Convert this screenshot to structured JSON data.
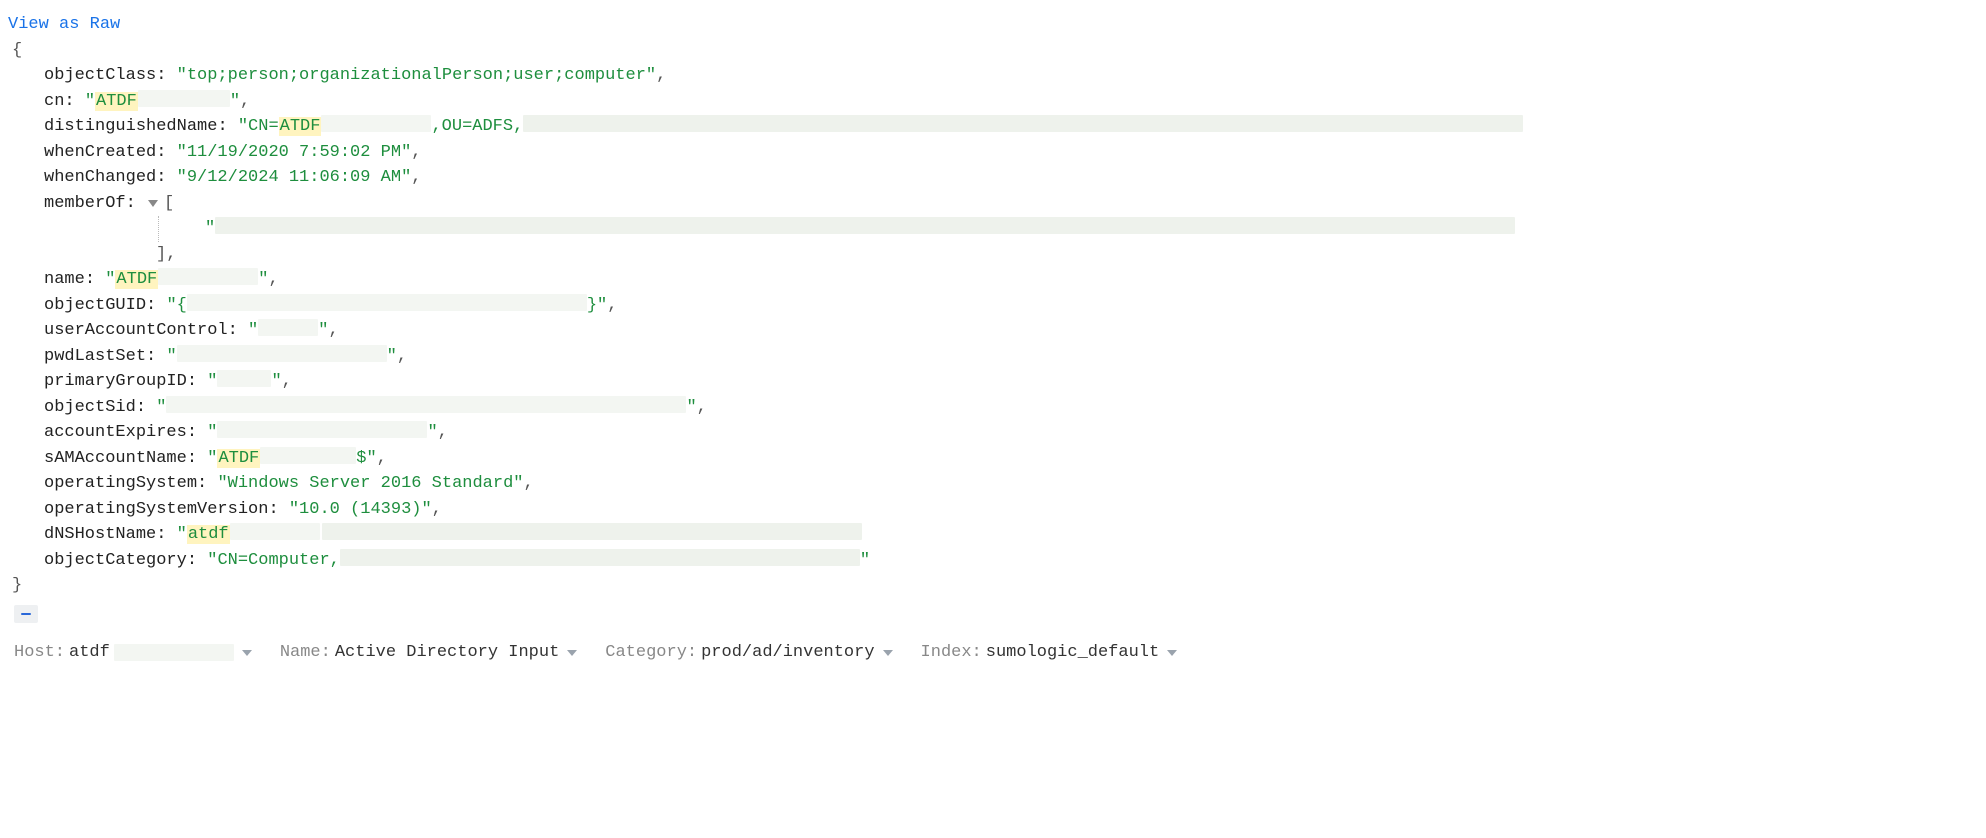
{
  "viewRawLabel": "View as Raw",
  "braces": {
    "open": "{",
    "close": "}"
  },
  "arr": {
    "open": "[",
    "close": "],",
    "quote": "\""
  },
  "fields": {
    "objectClass": {
      "key": "objectClass",
      "value": "top;person;organizationalPerson;user;computer"
    },
    "cn": {
      "key": "cn",
      "hlPrefix": "ATDF"
    },
    "distinguishedName": {
      "key": "distinguishedName",
      "prefix": "CN=",
      "hl": "ATDF",
      "mid": ",OU=ADFS,"
    },
    "whenCreated": {
      "key": "whenCreated",
      "value": "11/19/2020 7:59:02 PM"
    },
    "whenChanged": {
      "key": "whenChanged",
      "value": "9/12/2024 11:06:09 AM"
    },
    "memberOf": {
      "key": "memberOf"
    },
    "name": {
      "key": "name",
      "hlPrefix": "ATDF"
    },
    "objectGUID": {
      "key": "objectGUID",
      "pre": "{",
      "post": "}"
    },
    "userAccountControl": {
      "key": "userAccountControl"
    },
    "pwdLastSet": {
      "key": "pwdLastSet"
    },
    "primaryGroupID": {
      "key": "primaryGroupID"
    },
    "objectSid": {
      "key": "objectSid"
    },
    "accountExpires": {
      "key": "accountExpires"
    },
    "sAMAccountName": {
      "key": "sAMAccountName",
      "hl": "ATDF",
      "suffix": "$"
    },
    "operatingSystem": {
      "key": "operatingSystem",
      "value": "Windows Server 2016 Standard"
    },
    "operatingSystemVersion": {
      "key": "operatingSystemVersion",
      "value": "10.0 (14393)"
    },
    "dNSHostName": {
      "key": "dNSHostName",
      "hl": "atdf"
    },
    "objectCategory": {
      "key": "objectCategory",
      "prefix": "CN=Computer,"
    }
  },
  "meta": {
    "host": {
      "label": "Host:",
      "value": "atdf"
    },
    "name": {
      "label": "Name:",
      "value": "Active Directory Input"
    },
    "category": {
      "label": "Category:",
      "value": "prod/ad/inventory"
    },
    "index": {
      "label": "Index:",
      "value": "sumologic_default"
    }
  }
}
